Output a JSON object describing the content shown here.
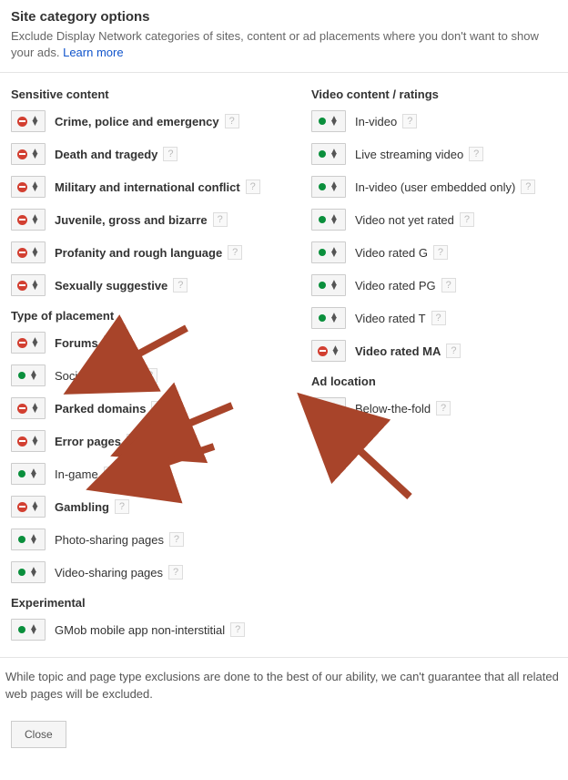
{
  "header": {
    "title": "Site category options",
    "subtitle": "Exclude Display Network categories of sites, content or ad placements where you don't want to show your ads. ",
    "learn_more": "Learn more"
  },
  "sections": {
    "sensitive": "Sensitive content",
    "placement": "Type of placement",
    "experimental": "Experimental",
    "video": "Video content / ratings",
    "adloc": "Ad location"
  },
  "items_left": {
    "s0": {
      "label": "Crime, police and emergency",
      "status": "excluded",
      "bold": true
    },
    "s1": {
      "label": "Death and tragedy",
      "status": "excluded",
      "bold": true
    },
    "s2": {
      "label": "Military and international conflict",
      "status": "excluded",
      "bold": true
    },
    "s3": {
      "label": "Juvenile, gross and bizarre",
      "status": "excluded",
      "bold": true
    },
    "s4": {
      "label": "Profanity and rough language",
      "status": "excluded",
      "bold": true
    },
    "s5": {
      "label": "Sexually suggestive",
      "status": "excluded",
      "bold": true
    },
    "p0": {
      "label": "Forums",
      "status": "excluded",
      "bold": true
    },
    "p1": {
      "label": "Social networks",
      "status": "included",
      "bold": false
    },
    "p2": {
      "label": "Parked domains",
      "status": "excluded",
      "bold": true
    },
    "p3": {
      "label": "Error pages",
      "status": "excluded",
      "bold": true
    },
    "p4": {
      "label": "In-game",
      "status": "included",
      "bold": false
    },
    "p5": {
      "label": "Gambling",
      "status": "excluded",
      "bold": true
    },
    "p6": {
      "label": "Photo-sharing pages",
      "status": "included",
      "bold": false
    },
    "p7": {
      "label": "Video-sharing pages",
      "status": "included",
      "bold": false
    },
    "e0": {
      "label": "GMob mobile app non-interstitial",
      "status": "included",
      "bold": false
    }
  },
  "items_right": {
    "v0": {
      "label": "In-video",
      "status": "included",
      "bold": false
    },
    "v1": {
      "label": "Live streaming video",
      "status": "included",
      "bold": false
    },
    "v2": {
      "label": "In-video (user embedded only)",
      "status": "included",
      "bold": false
    },
    "v3": {
      "label": "Video not yet rated",
      "status": "included",
      "bold": false
    },
    "v4": {
      "label": "Video rated G",
      "status": "included",
      "bold": false
    },
    "v5": {
      "label": "Video rated PG",
      "status": "included",
      "bold": false
    },
    "v6": {
      "label": "Video rated T",
      "status": "included",
      "bold": false
    },
    "v7": {
      "label": "Video rated MA",
      "status": "excluded",
      "bold": true
    },
    "a0": {
      "label": "Below-the-fold",
      "status": "included",
      "bold": false
    }
  },
  "footer_note": "While topic and page type exclusions are done to the best of our ability, we can't guarantee that all related web pages will be excluded.",
  "close": "Close",
  "help": "?"
}
